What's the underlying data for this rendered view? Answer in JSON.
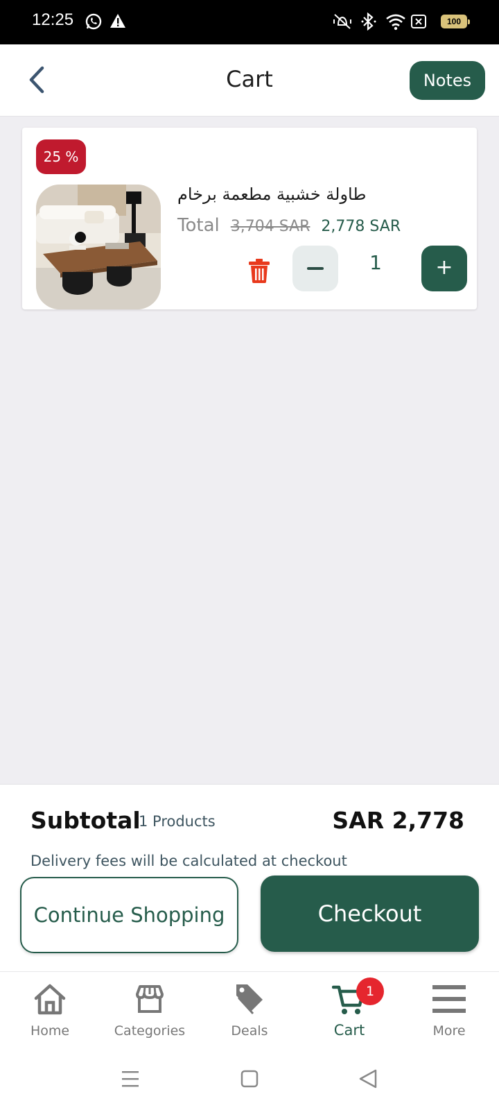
{
  "status_bar": {
    "time": "12:25",
    "battery": "100"
  },
  "header": {
    "title": "Cart",
    "notes_label": "Notes"
  },
  "cart_item": {
    "discount_badge": "25 %",
    "name": "طاولة خشبية مطعمة برخام",
    "total_label": "Total",
    "old_price": "3,704 SAR",
    "new_price": "2,778 SAR",
    "quantity": "1",
    "plus_label": "+"
  },
  "summary": {
    "subtotal_label": "Subtotal",
    "products_count": "1 Products",
    "subtotal_amount": "SAR 2,778",
    "delivery_note": "Delivery fees will be calculated at checkout",
    "continue_label": "Continue Shopping",
    "checkout_label": "Checkout"
  },
  "bottom_nav": {
    "items": [
      {
        "label": "Home",
        "icon": "home-icon"
      },
      {
        "label": "Categories",
        "icon": "store-icon"
      },
      {
        "label": "Deals",
        "icon": "tag-icon"
      },
      {
        "label": "Cart",
        "icon": "cart-icon",
        "badge": "1"
      },
      {
        "label": "More",
        "icon": "menu-icon"
      }
    ]
  },
  "colors": {
    "primary": "#265c4b",
    "discount": "#c01a2e",
    "delete": "#e8391c",
    "badge": "#e5262e"
  }
}
